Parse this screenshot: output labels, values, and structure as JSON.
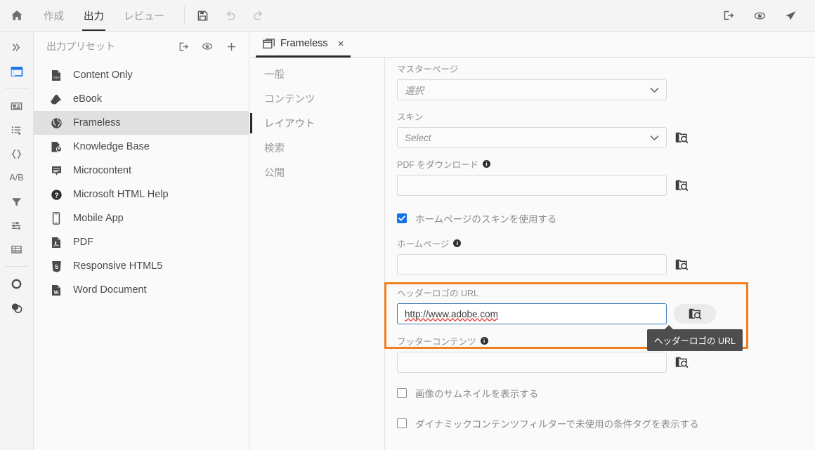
{
  "topbar": {
    "home_icon": "home-icon",
    "menu": [
      {
        "label": "作成",
        "active": false
      },
      {
        "label": "出力",
        "active": true
      },
      {
        "label": "レビュー",
        "active": false
      }
    ],
    "tools": [
      {
        "name": "save-icon",
        "label": "保存"
      },
      {
        "name": "undo-icon",
        "label": "元に戻す"
      },
      {
        "name": "redo-icon",
        "label": "やり直し"
      }
    ],
    "right_tools": [
      {
        "name": "publish-icon",
        "label": "公開"
      },
      {
        "name": "preview-icon",
        "label": "プレビュー"
      },
      {
        "name": "send-icon",
        "label": "送信"
      }
    ]
  },
  "rail": {
    "items": [
      {
        "name": "expand-chevrons-icon",
        "label": "展開",
        "active": false
      },
      {
        "name": "output-panel-icon",
        "label": "出力",
        "active": true
      },
      {
        "name": "master-page-icon",
        "label": "マスターページ",
        "active": false
      },
      {
        "name": "snippet-list-icon",
        "label": "スニペット",
        "active": false
      },
      {
        "name": "variables-braces-icon",
        "label": "変数",
        "active": false
      },
      {
        "name": "ab-condition-icon",
        "label": "A/B",
        "active": false
      },
      {
        "name": "filter-funnel-icon",
        "label": "フィルター",
        "active": false
      },
      {
        "name": "settings-sliders-icon",
        "label": "設定",
        "active": false
      },
      {
        "name": "table-grid-icon",
        "label": "テーブル",
        "active": false
      },
      {
        "name": "circle-icon",
        "label": "スタイル",
        "active": false
      },
      {
        "name": "overlap-circles-icon",
        "label": "レイヤー",
        "active": false
      }
    ]
  },
  "sidebar": {
    "title": "出力プリセット",
    "header_actions": [
      {
        "name": "generate-output-icon",
        "label": "出力生成"
      },
      {
        "name": "preview-eye-icon",
        "label": "プレビュー"
      },
      {
        "name": "add-plus-icon",
        "label": "追加"
      }
    ],
    "presets": [
      {
        "label": "Content Only",
        "icon": "content-only-icon",
        "selected": false
      },
      {
        "label": "eBook",
        "icon": "ebook-icon",
        "selected": false
      },
      {
        "label": "Frameless",
        "icon": "frameless-globe-icon",
        "selected": true
      },
      {
        "label": "Knowledge Base",
        "icon": "knowledge-base-icon",
        "selected": false
      },
      {
        "label": "Microcontent",
        "icon": "microcontent-icon",
        "selected": false
      },
      {
        "label": "Microsoft HTML Help",
        "icon": "html-help-icon",
        "selected": false
      },
      {
        "label": "Mobile App",
        "icon": "mobile-app-icon",
        "selected": false
      },
      {
        "label": "PDF",
        "icon": "pdf-icon",
        "selected": false
      },
      {
        "label": "Responsive HTML5",
        "icon": "html5-icon",
        "selected": false
      },
      {
        "label": "Word Document",
        "icon": "word-doc-icon",
        "selected": false
      }
    ]
  },
  "document_tab": {
    "label": "Frameless",
    "icon": "document-window-icon",
    "close": "×"
  },
  "section_nav": {
    "items": [
      {
        "label": "一般",
        "active": false
      },
      {
        "label": "コンテンツ",
        "active": false
      },
      {
        "label": "レイアウト",
        "active": true
      },
      {
        "label": "検索",
        "active": false
      },
      {
        "label": "公開",
        "active": false
      }
    ]
  },
  "form": {
    "master_page": {
      "label": "マスターページ",
      "value": "選択",
      "is_placeholder": true
    },
    "skin": {
      "label": "スキン",
      "value": "Select",
      "is_placeholder": true,
      "browse": "browse-folder-icon"
    },
    "download_pdf": {
      "label": "PDF をダウンロード",
      "value": "",
      "info": true,
      "browse": "browse-folder-icon"
    },
    "use_homepage_skin": {
      "label": "ホームページのスキンを使用する",
      "checked": true
    },
    "homepage": {
      "label": "ホームページ",
      "value": "",
      "info": true,
      "browse": "browse-folder-icon"
    },
    "header_logo_url": {
      "label": "ヘッダーロゴの URL",
      "value": "http://www.adobe.com",
      "focused": true,
      "browse": "browse-folder-icon"
    },
    "footer_content": {
      "label": "フッターコンテンツ",
      "value": "",
      "info": true,
      "browse": "browse-folder-icon"
    },
    "show_image_thumbnails": {
      "label": "画像のサムネイルを表示する",
      "checked": false
    },
    "show_unused_condition_tags": {
      "label": "ダイナミックコンテンツフィルターで未使用の条件タグを表示する",
      "checked": false
    }
  },
  "tooltip": {
    "text": "ヘッダーロゴの URL"
  },
  "colors": {
    "accent_blue": "#1473e6",
    "highlight_orange": "#ef7f1f",
    "tooltip_bg": "#4d4d4d",
    "focus_border": "#3a7ab5",
    "spellcheck_red": "#e8413a"
  }
}
